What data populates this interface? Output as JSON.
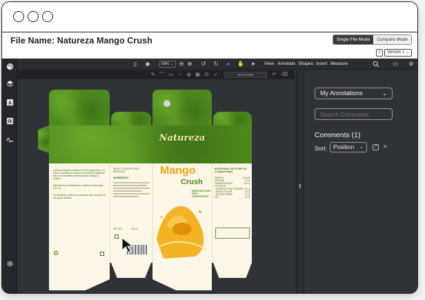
{
  "window": {
    "file_label": "File Name: Natureza Mango Crush"
  },
  "modes": {
    "single": "Single File Mode",
    "compare": "Compare Mode"
  },
  "version": {
    "label": "Version 1",
    "chevron": "⌄"
  },
  "toolbar": {
    "zoom": "50%",
    "menu": [
      "View",
      "Annotate",
      "Shapes",
      "Insert",
      "Measure"
    ]
  },
  "subtoolbar": {
    "preset": "No Presets"
  },
  "rail_icons": [
    "palette-icon",
    "layers-icon",
    "text-icon",
    "barcode-icon",
    "signature-icon",
    "settings-icon"
  ],
  "panel": {
    "annotations_dropdown": "My Annotations",
    "search_placeholder": "Search Comments",
    "comments_title": "Comments (1)",
    "sort_label": "Sort:",
    "sort_value": "Position"
  },
  "package": {
    "brand": "Natureza",
    "product_line1": "Mango",
    "product_line2": "Crush",
    "tagline": "MADE WITH 100% FRUIT CONCENTRATE",
    "net_qty_label": "NET QTY",
    "net_qty_value": "200 ml",
    "nutrition_title": "NUTRITIONAL FACTS PER 100 ml (Approximate)",
    "nutrition_rows": [
      [
        "ENERGY",
        "49 kcal"
      ],
      [
        "PROTEIN",
        "0.0 g"
      ],
      [
        "CARBOHYDRATE",
        "12.0 g"
      ],
      [
        "OF WHICH",
        ""
      ],
      [
        "- NATURAL FRUIT SUGARS",
        "6.0 g"
      ],
      [
        "- ADDED SUGAR",
        "6.0 g"
      ],
      [
        "- DIETARY FIBRE",
        "0.0 g"
      ],
      [
        "FAT",
        "0.0 g"
      ]
    ],
    "ready_to_serve": "READY TO SERVE FRUIT BEVERAGE",
    "ingredients_title": "INGREDIENTS:",
    "left_text": "Natureza Mango is made from 100% pulpy fruits. It is easy to consume as it does not involve the additional step of concentration which involves heating of product.",
    "manufacturer": "Manufactured & Marketed by: Natureza Technology Pvt. Ltd.",
    "feedback": "For feedback, contact our consumer care executive at the above address."
  },
  "colors": {
    "app_bg": "#2f3237",
    "rail_bg": "#23262a",
    "package_green": "#4d8a1e",
    "package_cream": "#fbf6e6",
    "mango_orange": "#f2a317"
  }
}
